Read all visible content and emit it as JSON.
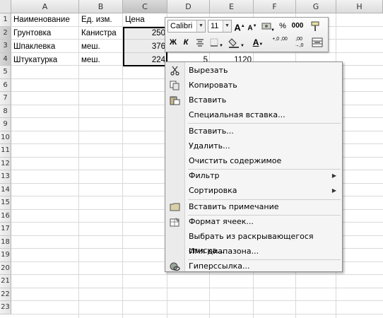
{
  "spreadsheet": {
    "columns": [
      "A",
      "B",
      "C",
      "D",
      "E",
      "F",
      "G",
      "H"
    ],
    "rows": [
      "1",
      "2",
      "3",
      "4",
      "5",
      "6",
      "7",
      "8",
      "9",
      "10",
      "11",
      "12",
      "13",
      "14",
      "15",
      "16",
      "17",
      "18",
      "19",
      "20",
      "21",
      "22",
      "23"
    ],
    "cells": {
      "A1": "Наименование",
      "B1": "Ед. изм.",
      "C1": "Цена",
      "A2": "Грунтовка",
      "B2": "Канистра",
      "C2": "250",
      "A3": "Шпаклевка",
      "B3": "меш.",
      "C3": "376",
      "A4": "Штукатурка",
      "B4": "меш.",
      "C4": "224",
      "D4": "5",
      "E4": "1120"
    }
  },
  "mini_toolbar": {
    "font_name": "Calibri",
    "font_size": "11",
    "grow_font": "A",
    "shrink_font": "A",
    "percent": "%",
    "thousands": "000",
    "bold": "Ж",
    "italic": "К",
    "font_color": "A",
    "increase_decimal": "+,0 ,00",
    "decrease_decimal": ",00 →,0"
  },
  "context_menu": {
    "items": [
      {
        "label": "Вырезать",
        "icon": "scissors-icon"
      },
      {
        "label": "Копировать",
        "icon": "copy-icon"
      },
      {
        "label": "Вставить",
        "icon": "paste-icon"
      },
      {
        "label": "Специальная вставка..."
      },
      {
        "label": "Вставить..."
      },
      {
        "label": "Удалить..."
      },
      {
        "label": "Очистить содержимое"
      },
      {
        "label": "Фильтр",
        "submenu": true
      },
      {
        "label": "Сортировка",
        "submenu": true
      },
      {
        "label": "Вставить примечание",
        "icon": "comment-icon"
      },
      {
        "label": "Формат ячеек...",
        "icon": "format-cells-icon"
      },
      {
        "label": "Выбрать из раскрывающегося списка..."
      },
      {
        "label": "Имя диапазона..."
      },
      {
        "label": "Гиперссылка...",
        "icon": "hyperlink-icon"
      }
    ]
  }
}
